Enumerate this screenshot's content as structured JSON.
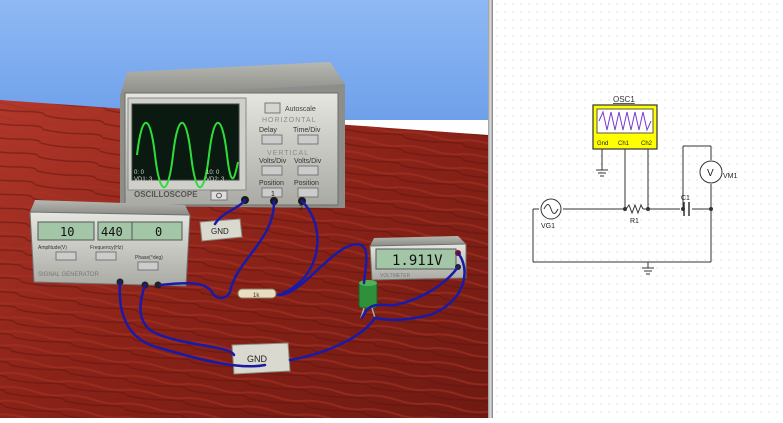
{
  "scene": {
    "oscilloscope": {
      "brand": "OSCILLOSCOPE",
      "autoscale": "Autoscale",
      "horizontal": "HORIZONTAL",
      "vertical": "VERTICAL",
      "delay": "Delay",
      "time_div": "Time/Div",
      "volts_div_1": "Volts/Div",
      "volts_div_2": "Volts/Div",
      "position_1": "Position",
      "position_2": "Position",
      "readout_left_1": "0: 0",
      "readout_left_2": "VD1: 3",
      "readout_right_1": "10: 0",
      "readout_right_2": "VD2: 3",
      "ch1": "1",
      "ch2": "2"
    },
    "signal_generator": {
      "brand": "SIGNAL GENERATOR",
      "amplitude_value": "10",
      "frequency_value": "440",
      "phase_value": "0",
      "amplitude_label": "Amplitude(V)",
      "frequency_label": "Frequency(Hz)",
      "phase_label": "Phase(°deg)"
    },
    "voltmeter": {
      "reading": "1.911V",
      "brand": "VOLTMETER"
    },
    "gnd_top": "GND",
    "gnd_bottom": "GND",
    "resistor_label": "1k"
  },
  "schematic": {
    "osc_label": "OSC1",
    "osc_pins": [
      "Gnd",
      "Ch1",
      "Ch2"
    ],
    "r1": "R1",
    "c1": "C1",
    "vg1": "VG1",
    "vm1": "VM1",
    "vm_symbol": "V",
    "trace_color": "#7a3bd0",
    "osc_fill": "#ffff00"
  }
}
